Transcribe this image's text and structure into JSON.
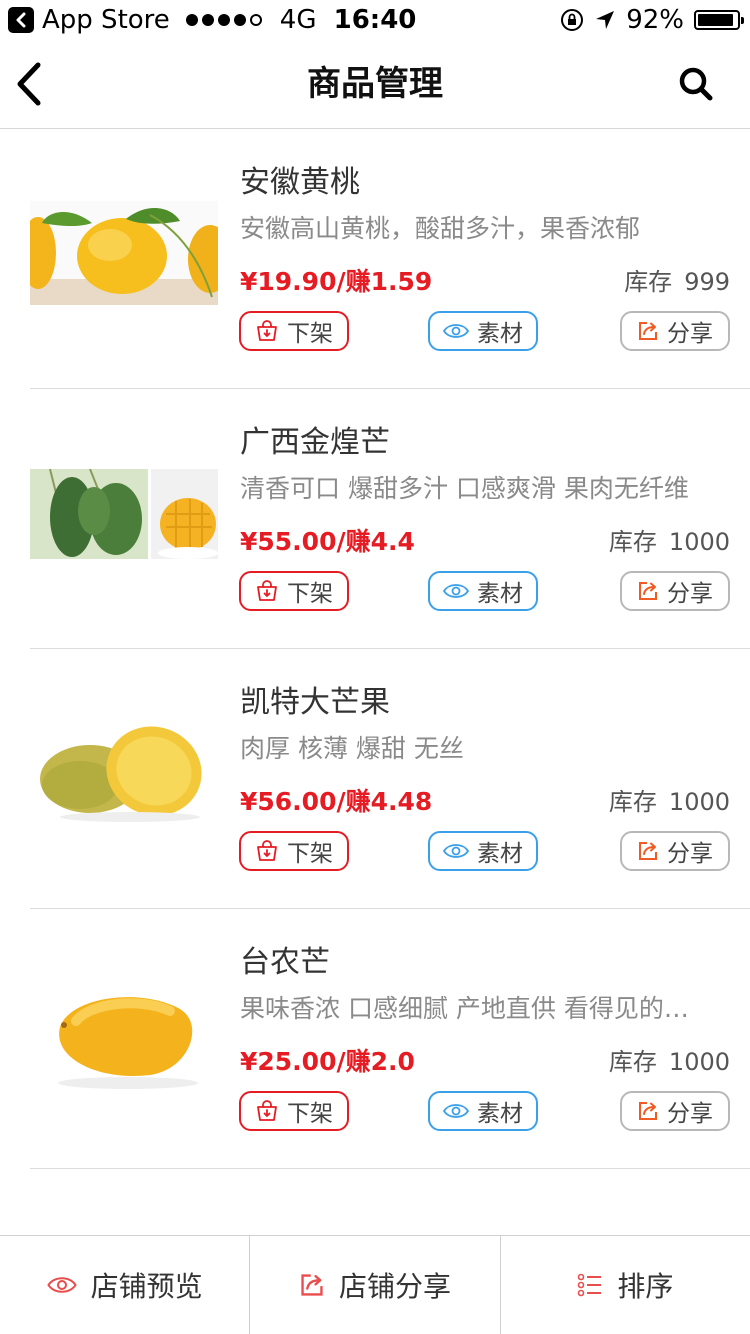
{
  "status_bar": {
    "back_app": "App Store",
    "network": "4G",
    "time": "16:40",
    "battery": "92%",
    "battery_level": 0.92
  },
  "nav": {
    "title": "商品管理"
  },
  "colors": {
    "price": "#e51c23",
    "off_button_border": "#e51c23",
    "material_button_border": "#3aa0e8",
    "share_icon": "#f15a22"
  },
  "products": [
    {
      "name": "安徽黄桃",
      "description": "安徽高山黄桃，酸甜多汁，果香浓郁",
      "price": "¥19.90/赚1.59",
      "stock_label": "库存",
      "stock": "999",
      "actions": {
        "off": "下架",
        "material": "素材",
        "share": "分享"
      }
    },
    {
      "name": "广西金煌芒",
      "description": "清香可口 爆甜多汁 口感爽滑 果肉无纤维",
      "price": "¥55.00/赚4.4",
      "stock_label": "库存",
      "stock": "1000",
      "actions": {
        "off": "下架",
        "material": "素材",
        "share": "分享"
      }
    },
    {
      "name": "凯特大芒果",
      "description": "肉厚 核薄 爆甜 无丝",
      "price": "¥56.00/赚4.48",
      "stock_label": "库存",
      "stock": "1000",
      "actions": {
        "off": "下架",
        "material": "素材",
        "share": "分享"
      }
    },
    {
      "name": "台农芒",
      "description": "果味香浓 口感细腻 产地直供 看得见的…",
      "price": "¥25.00/赚2.0",
      "stock_label": "库存",
      "stock": "1000",
      "actions": {
        "off": "下架",
        "material": "素材",
        "share": "分享"
      }
    }
  ],
  "toolbar": {
    "preview": "店铺预览",
    "share": "店铺分享",
    "sort": "排序"
  }
}
